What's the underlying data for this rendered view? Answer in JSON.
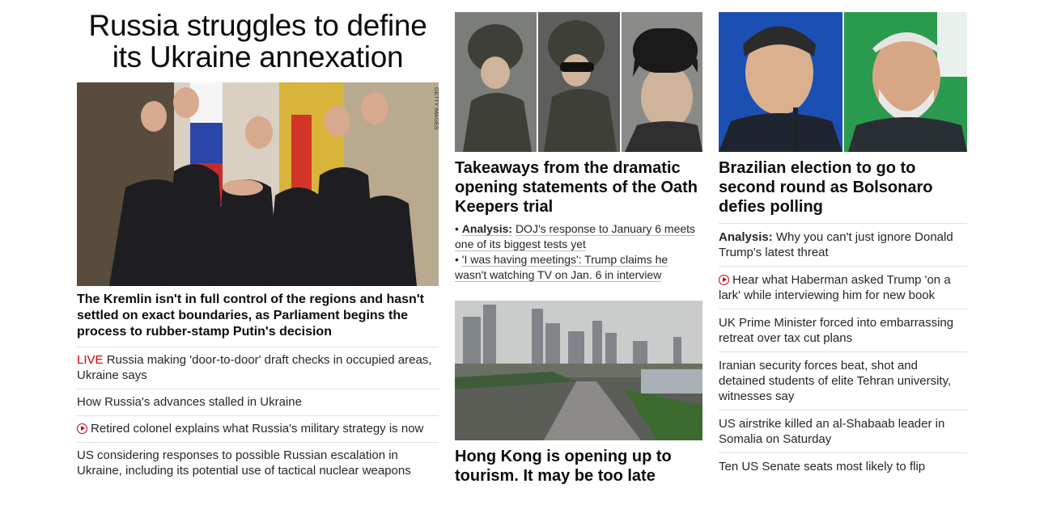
{
  "col1": {
    "title": "Russia struggles to define its Ukraine annexation",
    "image_credit": "GETTY IMAGES",
    "subtitle": "The Kremlin isn't in full control of the regions and hasn't settled on exact boundaries, as Parliament begins the process to rubber-stamp Putin's decision",
    "links": [
      {
        "prefix": "LIVE",
        "text": "Russia making 'door-to-door' draft checks in occupied areas, Ukraine says"
      },
      {
        "text": "How Russia's advances stalled in Ukraine"
      },
      {
        "icon": "play-icon",
        "text": "Retired colonel explains what Russia's military strategy is now"
      },
      {
        "text": "US considering responses to possible Russian escalation in Ukraine, including its potential use of tactical nuclear weapons"
      }
    ]
  },
  "col2": {
    "story1": {
      "headline": "Takeaways from the dramatic opening statements of the Oath Keepers trial",
      "bullets": [
        {
          "bold": "Analysis:",
          "text": "DOJ's response to January 6 meets one of its biggest tests yet"
        },
        {
          "text": "'I was having meetings': Trump claims he wasn't watching TV on Jan. 6 in interview"
        }
      ]
    },
    "story2": {
      "headline": "Hong Kong is opening up to tourism. It may be too late"
    }
  },
  "col3": {
    "headline": "Brazilian election to go to second round as Bolsonaro defies polling",
    "links": [
      {
        "bold": "Analysis:",
        "text": "Why you can't just ignore Donald Trump's latest threat"
      },
      {
        "icon": "play-icon",
        "text": "Hear what Haberman asked Trump 'on a lark' while interviewing him for new book"
      },
      {
        "text": "UK Prime Minister forced into embarrassing retreat over tax cut plans"
      },
      {
        "text": "Iranian security forces beat, shot and detained students of elite Tehran university, witnesses say"
      },
      {
        "text": "US airstrike killed an al-Shabaab leader in Somalia on Saturday"
      },
      {
        "text": "Ten US Senate seats most likely to flip"
      }
    ]
  },
  "colors": {
    "live_red": "#cc0000",
    "text": "#0c0c0c",
    "divider": "#e0e0e0"
  }
}
